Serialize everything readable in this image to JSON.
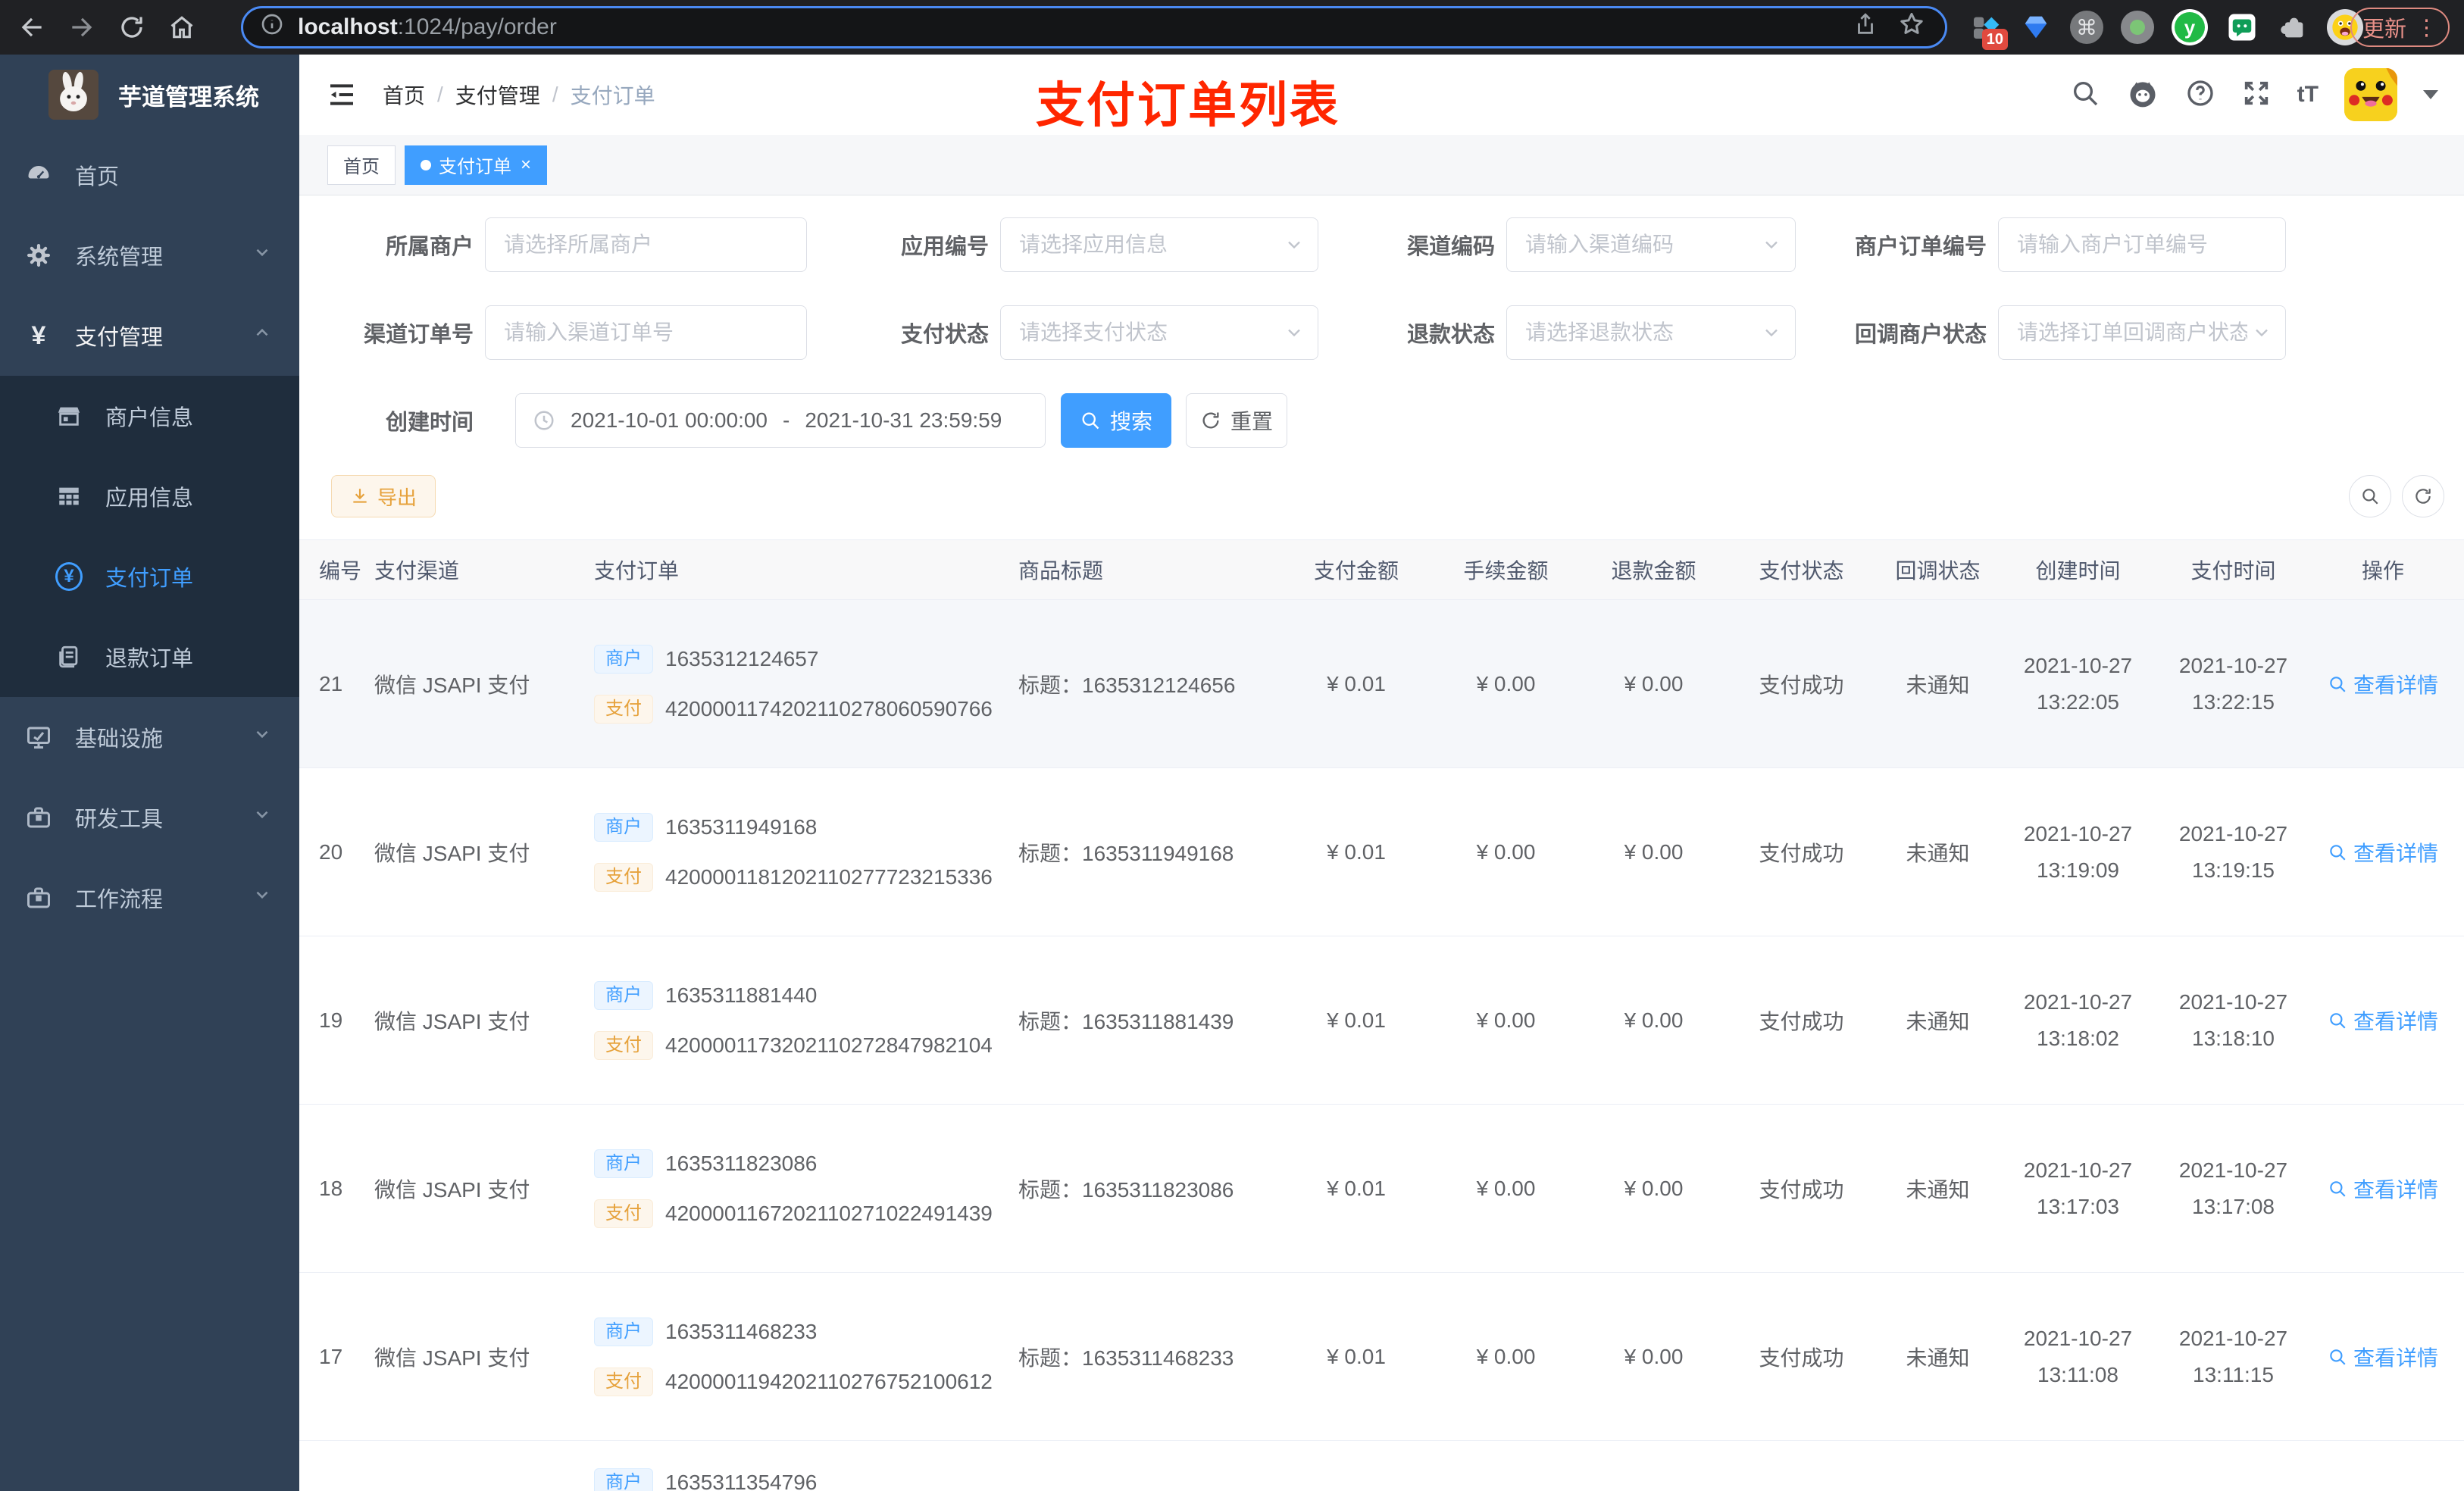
{
  "colors": {
    "accent": "#409eff",
    "warning": "#e6a23c",
    "annotation_red": "#ff2600",
    "sidebar_bg": "#304156",
    "sidebar_sub_bg": "#1f2d3d"
  },
  "browser": {
    "url_host": "localhost",
    "url_rest": ":1024/pay/order",
    "ext_badge": "10",
    "command_glyph": "⌘",
    "y_glyph": "y",
    "update_label": "更新",
    "menu_dots": "⋮"
  },
  "sidebar": {
    "title": "芋道管理系统",
    "items": [
      {
        "label": "首页"
      },
      {
        "label": "系统管理"
      },
      {
        "label": "支付管理"
      },
      {
        "label": "商户信息"
      },
      {
        "label": "应用信息"
      },
      {
        "label": "支付订单"
      },
      {
        "label": "退款订单"
      },
      {
        "label": "基础设施"
      },
      {
        "label": "研发工具"
      },
      {
        "label": "工作流程"
      }
    ],
    "yen_glyph": "¥"
  },
  "header": {
    "breadcrumb": [
      "首页",
      "支付管理",
      "支付订单"
    ],
    "separator": "/",
    "annotation": "支付订单列表",
    "font_size_icon_text": "tT"
  },
  "tabs": {
    "items": [
      {
        "label": "首页"
      },
      {
        "label": "支付订单"
      }
    ],
    "close": "×"
  },
  "filters": {
    "fields": [
      {
        "label": "所属商户",
        "placeholder": "请选择所属商户"
      },
      {
        "label": "应用编号",
        "placeholder": "请选择应用信息"
      },
      {
        "label": "渠道编码",
        "placeholder": "请输入渠道编码"
      },
      {
        "label": "商户订单编号",
        "placeholder": "请输入商户订单编号"
      },
      {
        "label": "渠道订单号",
        "placeholder": "请输入渠道订单号"
      },
      {
        "label": "支付状态",
        "placeholder": "请选择支付状态"
      },
      {
        "label": "退款状态",
        "placeholder": "请选择退款状态"
      },
      {
        "label": "回调商户状态",
        "placeholder": "请选择订单回调商户状态"
      }
    ],
    "date_label": "创建时间",
    "date_start": "2021-10-01 00:00:00",
    "date_separator": "-",
    "date_end": "2021-10-31 23:59:59",
    "search_label": "搜索",
    "reset_label": "重置"
  },
  "toolbar": {
    "export_label": "导出"
  },
  "table": {
    "headers": [
      "编号",
      "支付渠道",
      "支付订单",
      "商品标题",
      "支付金额",
      "手续金额",
      "退款金额",
      "支付状态",
      "回调状态",
      "创建时间",
      "支付时间",
      "操作"
    ],
    "merchant_tag": "商户",
    "pay_tag": "支付",
    "title_prefix": "标题：",
    "view_label": "查看详情",
    "rows": [
      {
        "id": "21",
        "channel": "微信 JSAPI 支付",
        "merchant_no": "1635312124657",
        "pay_no": "4200001174202110278060590766",
        "title": "1635312124656",
        "amount": "¥ 0.01",
        "fee": "¥ 0.00",
        "refund": "¥ 0.00",
        "status": "支付成功",
        "notify": "未通知",
        "created_date": "2021-10-27",
        "created_time": "13:22:05",
        "paid_date": "2021-10-27",
        "paid_time": "13:22:15"
      },
      {
        "id": "20",
        "channel": "微信 JSAPI 支付",
        "merchant_no": "1635311949168",
        "pay_no": "4200001181202110277723215336",
        "title": "1635311949168",
        "amount": "¥ 0.01",
        "fee": "¥ 0.00",
        "refund": "¥ 0.00",
        "status": "支付成功",
        "notify": "未通知",
        "created_date": "2021-10-27",
        "created_time": "13:19:09",
        "paid_date": "2021-10-27",
        "paid_time": "13:19:15"
      },
      {
        "id": "19",
        "channel": "微信 JSAPI 支付",
        "merchant_no": "1635311881440",
        "pay_no": "4200001173202110272847982104",
        "title": "1635311881439",
        "amount": "¥ 0.01",
        "fee": "¥ 0.00",
        "refund": "¥ 0.00",
        "status": "支付成功",
        "notify": "未通知",
        "created_date": "2021-10-27",
        "created_time": "13:18:02",
        "paid_date": "2021-10-27",
        "paid_time": "13:18:10"
      },
      {
        "id": "18",
        "channel": "微信 JSAPI 支付",
        "merchant_no": "1635311823086",
        "pay_no": "4200001167202110271022491439",
        "title": "1635311823086",
        "amount": "¥ 0.01",
        "fee": "¥ 0.00",
        "refund": "¥ 0.00",
        "status": "支付成功",
        "notify": "未通知",
        "created_date": "2021-10-27",
        "created_time": "13:17:03",
        "paid_date": "2021-10-27",
        "paid_time": "13:17:08"
      },
      {
        "id": "17",
        "channel": "微信 JSAPI 支付",
        "merchant_no": "1635311468233",
        "pay_no": "4200001194202110276752100612",
        "title": "1635311468233",
        "amount": "¥ 0.01",
        "fee": "¥ 0.00",
        "refund": "¥ 0.00",
        "status": "支付成功",
        "notify": "未通知",
        "created_date": "2021-10-27",
        "created_time": "13:11:08",
        "paid_date": "2021-10-27",
        "paid_time": "13:11:15"
      }
    ],
    "partial_row": {
      "merchant_no": "1635311354796"
    }
  }
}
